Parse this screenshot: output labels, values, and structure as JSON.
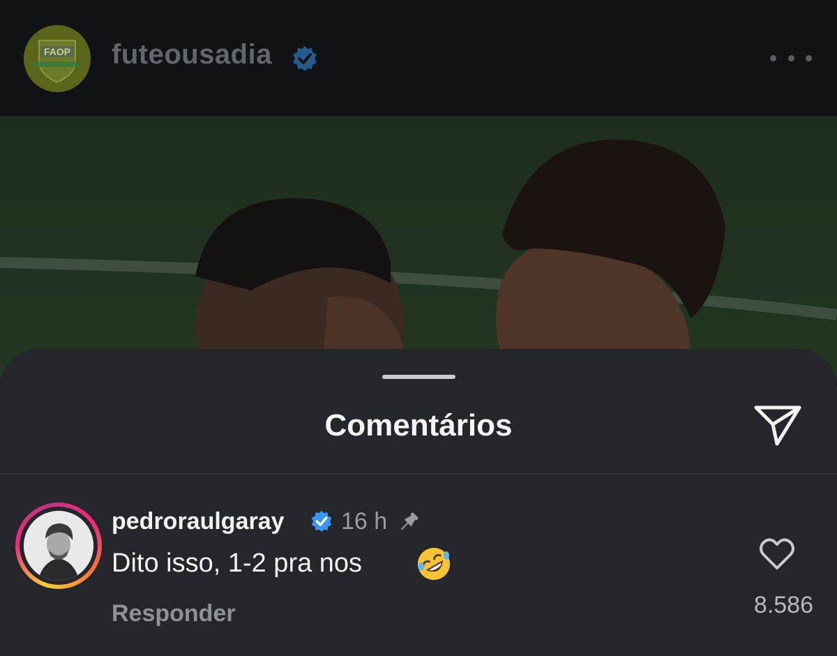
{
  "post": {
    "username": "futeousadia",
    "avatar_text": "FAOP",
    "verified": true,
    "more_icon": "more-horizontal-icon"
  },
  "comments_sheet": {
    "title": "Comentários",
    "share_icon": "paper-plane-icon"
  },
  "comments": [
    {
      "username": "pedroraulgaray",
      "verified": true,
      "time": "16 h",
      "pinned": true,
      "text": "Dito isso, 1-2 pra nos",
      "emoji": "rolling-on-floor-laughing-icon",
      "reply_label": "Responder",
      "likes": "8.586"
    }
  ],
  "colors": {
    "verified_blue": "#3897f0",
    "sheet_bg": "#24262b",
    "header_bg": "#101216"
  }
}
